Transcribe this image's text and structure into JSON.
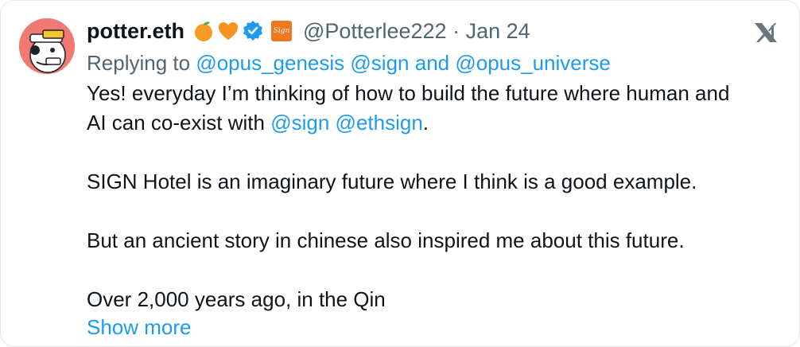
{
  "author": {
    "display_name": "potter.eth",
    "handle": "@Potterlee222",
    "separator": "·",
    "date": "Jan 24",
    "badges": [
      "orange-fruit-icon",
      "orange-heart-icon",
      "verified-badge-icon",
      "sign-affiliate-badge-icon"
    ],
    "badge_text": "Sign"
  },
  "reply": {
    "prefix": "Replying to",
    "mention_1": "@opus_genesis",
    "mention_2": "@sign",
    "connector": "and",
    "mention_3": "@opus_universe"
  },
  "body": {
    "line1": "Yes! everyday I’m thinking of how to build the future where human and",
    "line2_prefix": "AI can co-exist with",
    "line2_mention_1": "@sign",
    "line2_mention_2": "@ethsign",
    "line2_suffix": ".",
    "para2": "SIGN Hotel is an imaginary future where I think is a good example.",
    "para3": "But an ancient story in chinese also inspired me about this future.",
    "para4": "Over 2,000 years ago, in the Qin",
    "show_more": "Show more"
  },
  "icons": {
    "platform": "x-logo-icon",
    "avatar": "avatar"
  },
  "colors": {
    "link": "#1d9bf0",
    "secondary_text": "#536471",
    "primary_text": "#0f1419",
    "avatar_bg": "#f07a73",
    "verified": "#1d9bf0",
    "sign_badge": "#f2781f"
  }
}
